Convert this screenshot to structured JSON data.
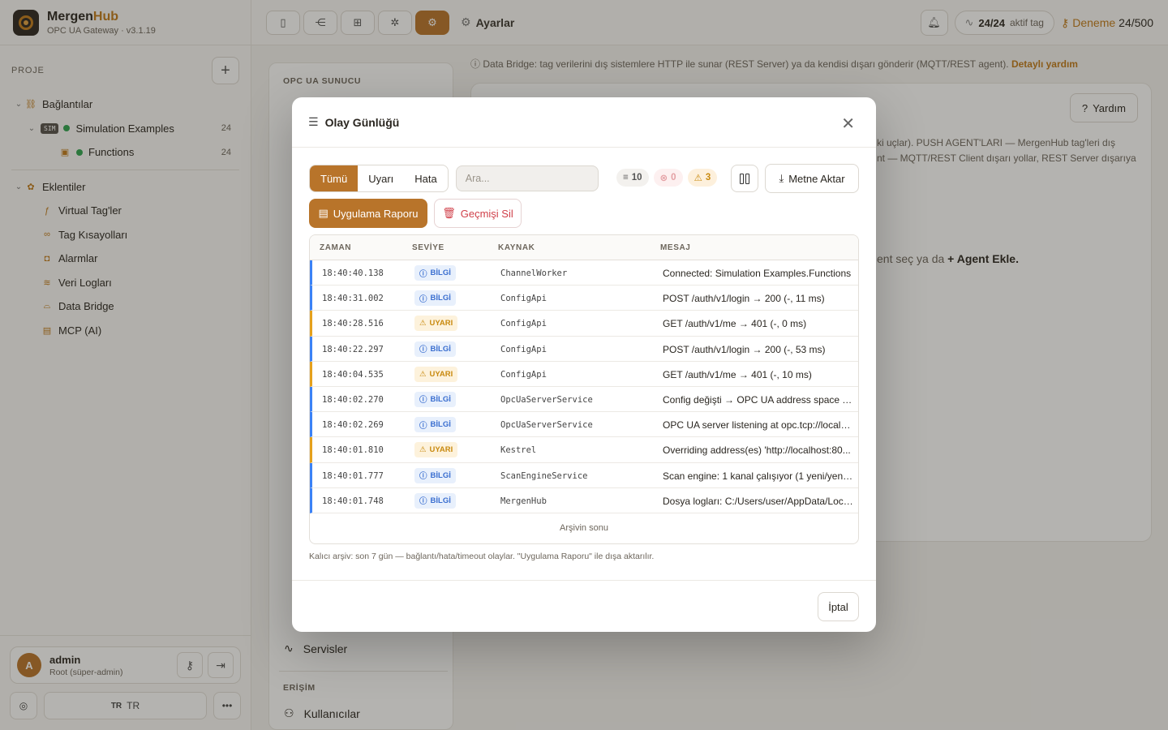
{
  "brand": {
    "name_main": "Mergen",
    "name_accent": "Hub",
    "subtitle": "OPC UA Gateway · v3.1.19"
  },
  "sidebar": {
    "project_label": "PROJE",
    "connections": {
      "label": "Bağlantılar",
      "children": [
        {
          "label": "Simulation Examples",
          "badge": "SIM",
          "count": "24"
        },
        {
          "label": "Functions",
          "count": "24"
        }
      ]
    },
    "plugins": {
      "label": "Eklentiler",
      "items": [
        {
          "label": "Virtual Tag'ler",
          "icon": "function-icon"
        },
        {
          "label": "Tag Kısayolları",
          "icon": "link-icon"
        },
        {
          "label": "Alarmlar",
          "icon": "bell-icon"
        },
        {
          "label": "Veri Logları",
          "icon": "database-icon"
        },
        {
          "label": "Data Bridge",
          "icon": "bridge-icon"
        },
        {
          "label": "MCP (AI)",
          "icon": "ai-icon"
        }
      ]
    },
    "user": {
      "initial": "A",
      "name": "admin",
      "role": "Root (süper-admin)"
    },
    "language": {
      "code": "TR",
      "label": "TR"
    }
  },
  "topbar": {
    "breadcrumb": "Ayarlar",
    "tags_active": "24/24",
    "tags_label": "aktif tag",
    "trial_label": "Deneme",
    "trial_value": "24/500"
  },
  "background": {
    "mid_header": "OPC UA SUNUCU",
    "mid_items": {
      "services": "Servisler",
      "access_header": "ERİŞİM",
      "users": "Kullanıcılar"
    },
    "info_text": "Data Bridge: tag verilerini dış sistemlere HTTP ile sunar (REST Server) ya da kendisi dışarı gönderir (MQTT/REST agent).",
    "info_link": "Detaylı yardım",
    "help_button": "Yardım",
    "right_text_1": "ki uçlar). PUSH AGENT'LARI — MergenHub tag'leri dış",
    "right_text_2": "nt — MQTT/REST Client dışarı yollar, REST Server dışarıya",
    "right_empty": "ent seç ya da",
    "right_empty_bold": "+ Agent Ekle."
  },
  "modal": {
    "title": "Olay Günlüğü",
    "filters": [
      "Tümü",
      "Uyarı",
      "Hata"
    ],
    "search_placeholder": "Ara...",
    "counts": {
      "total": "10",
      "errors": "0",
      "warnings": "3"
    },
    "export_label": "Metne Aktar",
    "report_label": "Uygulama Raporu",
    "clear_label": "Geçmişi Sil",
    "columns": {
      "time": "ZAMAN",
      "level": "SEVİYE",
      "source": "KAYNAK",
      "message": "MESAJ"
    },
    "rows": [
      {
        "time": "18:40:40.138",
        "level": "BİLGİ",
        "source": "ChannelWorker",
        "message": "Connected: Simulation Examples.Functions"
      },
      {
        "time": "18:40:31.002",
        "level": "BİLGİ",
        "source": "ConfigApi",
        "message": "POST /auth/v1/login → 200 (-, 11 ms)"
      },
      {
        "time": "18:40:28.516",
        "level": "UYARI",
        "source": "ConfigApi",
        "message": "GET /auth/v1/me → 401 (-, 0 ms)"
      },
      {
        "time": "18:40:22.297",
        "level": "BİLGİ",
        "source": "ConfigApi",
        "message": "POST /auth/v1/login → 200 (-, 53 ms)"
      },
      {
        "time": "18:40:04.535",
        "level": "UYARI",
        "source": "ConfigApi",
        "message": "GET /auth/v1/me → 401 (-, 10 ms)"
      },
      {
        "time": "18:40:02.270",
        "level": "BİLGİ",
        "source": "OpcUaServerService",
        "message": "Config değişti → OPC UA address space Y..."
      },
      {
        "time": "18:40:02.269",
        "level": "BİLGİ",
        "source": "OpcUaServerService",
        "message": "OPC UA server listening at opc.tcp://localh..."
      },
      {
        "time": "18:40:01.810",
        "level": "UYARI",
        "source": "Kestrel",
        "message": "Overriding address(es) 'http://localhost:80..."
      },
      {
        "time": "18:40:01.777",
        "level": "BİLGİ",
        "source": "ScanEngineService",
        "message": "Scan engine: 1 kanal çalışıyor (1 yeni/yenid..."
      },
      {
        "time": "18:40:01.748",
        "level": "BİLGİ",
        "source": "MergenHub",
        "message": "Dosya logları: C:/Users/user/AppData/Loca..."
      }
    ],
    "table_footer": "Arşivin sonu",
    "archive_note": "Kalıcı arşiv: son 7 gün — bağlantı/hata/timeout olaylar. \"Uygulama Raporu\" ile dışa aktarılır.",
    "cancel_label": "İptal"
  },
  "colors": {
    "accent": "#b8742a",
    "info": "#3b82f6",
    "warning": "#e5a11c",
    "danger": "#d0404a"
  }
}
